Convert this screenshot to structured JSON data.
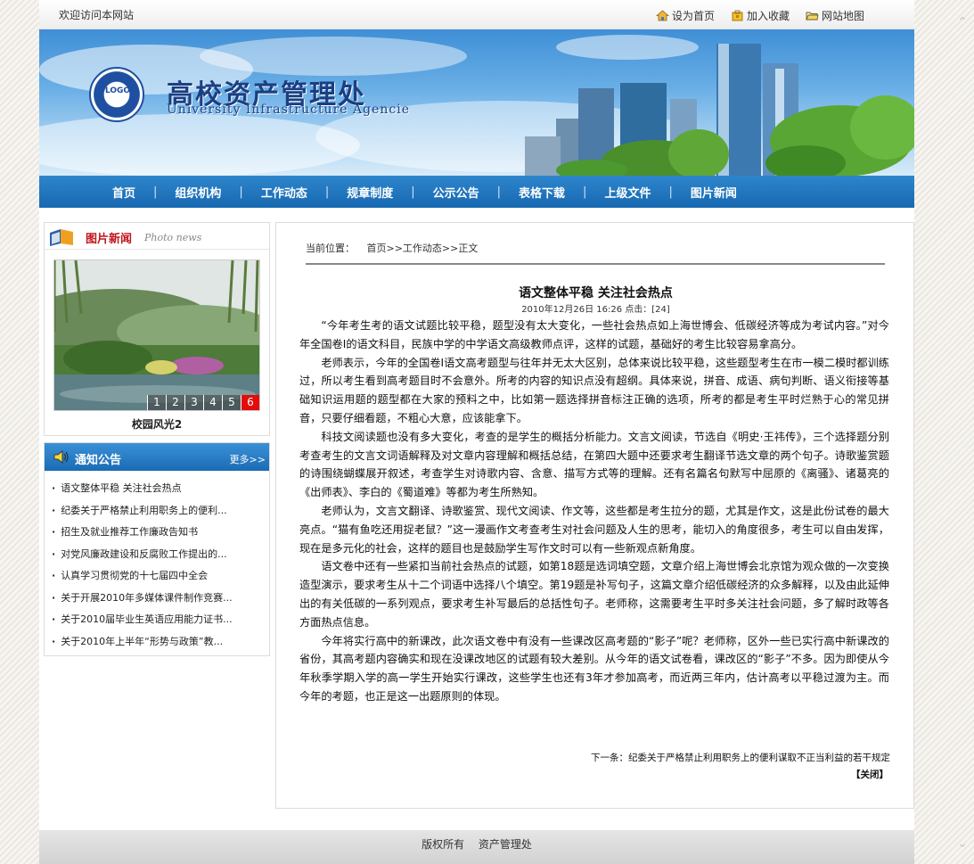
{
  "topbar": {
    "welcome": "欢迎访问本网站",
    "links": [
      {
        "label": "设为首页",
        "icon": "home-icon"
      },
      {
        "label": "加入收藏",
        "icon": "favorite-icon"
      },
      {
        "label": "网站地图",
        "icon": "folder-icon"
      }
    ]
  },
  "banner": {
    "title": "高校资产管理处",
    "subtitle": "University Infrastructure Agencie",
    "logo_text": "LOGO"
  },
  "nav": {
    "items": [
      "首页",
      "组织机构",
      "工作动态",
      "规章制度",
      "公示公告",
      "表格下载",
      "上级文件",
      "图片新闻"
    ]
  },
  "photo_news": {
    "title": "图片新闻",
    "title_en": "Photo  news",
    "pages": [
      "1",
      "2",
      "3",
      "4",
      "5",
      "6"
    ],
    "active_page": 6,
    "caption": "校园风光2"
  },
  "notice": {
    "title": "通知公告",
    "more": "更多>>",
    "items": [
      "语文整体平稳 关注社会热点",
      "纪委关于严格禁止利用职务上的便利...",
      "招生及就业推荐工作廉政告知书",
      "对党风廉政建设和反腐败工作提出的...",
      "认真学习贯彻党的十七届四中全会",
      "关于开展2010年多媒体课件制作竞赛...",
      "关于2010届毕业生英语应用能力证书...",
      "关于2010年上半年“形势与政策”教..."
    ]
  },
  "breadcrumb": {
    "label": "当前位置：",
    "path": "首页>>工作动态>>正文"
  },
  "article": {
    "title": "语文整体平稳 关注社会热点",
    "meta": "2010年12月26日  16:26  点击：[24]",
    "paragraphs": [
      "“今年考生考的语文试题比较平稳，题型没有太大变化，一些社会热点如上海世博会、低碳经济等成为考试内容。”对今年全国卷Ⅰ的语文科目，民族中学的中学语文高级教师点评，这样的试题，基础好的考生比较容易拿高分。",
      "老师表示，今年的全国卷Ⅰ语文高考题型与往年并无太大区别，总体来说比较平稳，这些题型考生在市一模二模时都训练过，所以考生看到高考题目时不会意外。所考的内容的知识点没有超纲。具体来说，拼音、成语、病句判断、语义衔接等基础知识运用题的题型都在大家的预料之中，比如第一题选择拼音标注正确的选项，所考的都是考生平时烂熟于心的常见拼音，只要仔细看题，不粗心大意，应该能拿下。",
      "科技文阅读题也没有多大变化，考查的是学生的概括分析能力。文言文阅读，节选自《明史·王祎传》，三个选择题分别考查考生的文言文词语解释及对文章内容理解和概括总结，在第四大题中还要求考生翻译节选文章的两个句子。诗歌鉴赏题的诗围绕蝴蝶展开叙述，考查学生对诗歌内容、含意、描写方式等的理解。还有名篇名句默写中屈原的《离骚》、诸葛亮的《出师表》、李白的《蜀道难》等都为考生所熟知。",
      "老师认为，文言文翻译、诗歌鉴赏、现代文阅读、作文等，这些都是考生拉分的题，尤其是作文，这是此份试卷的最大亮点。“猫有鱼吃还用捉老鼠？”这一漫画作文考查考生对社会问题及人生的思考，能切入的角度很多，考生可以自由发挥，现在是多元化的社会，这样的题目也是鼓励学生写作文时可以有一些新观点新角度。",
      "语文卷中还有一些紧扣当前社会热点的试题，如第18题是选词填空题，文章介绍上海世博会北京馆为观众做的一次变换造型演示，要求考生从十二个词语中选择八个填空。第19题是补写句子，这篇文章介绍低碳经济的众多解释，以及由此延伸出的有关低碳的一系列观点，要求考生补写最后的总括性句子。老师称，这需要考生平时多关注社会问题，多了解时政等各方面热点信息。",
      "今年将实行高中的新课改，此次语文卷中有没有一些课改区高考题的“影子”呢？老师称，区外一些已实行高中新课改的省份，其高考题内容确实和现在没课改地区的试题有较大差别。从今年的语文试卷看，课改区的“影子”不多。因为即使从今年秋季学期入学的高一学生开始实行课改，这些学生也还有3年才参加高考，而近两三年内，估计高考以平稳过渡为主。而今年的考题，也正是这一出题原则的体现。"
    ],
    "next": "下一条：纪委关于严格禁止利用职务上的便利谋取不正当利益的若干规定",
    "close": "【关闭】"
  },
  "footer": {
    "copyright": "版权所有",
    "owner": "资产管理处"
  }
}
